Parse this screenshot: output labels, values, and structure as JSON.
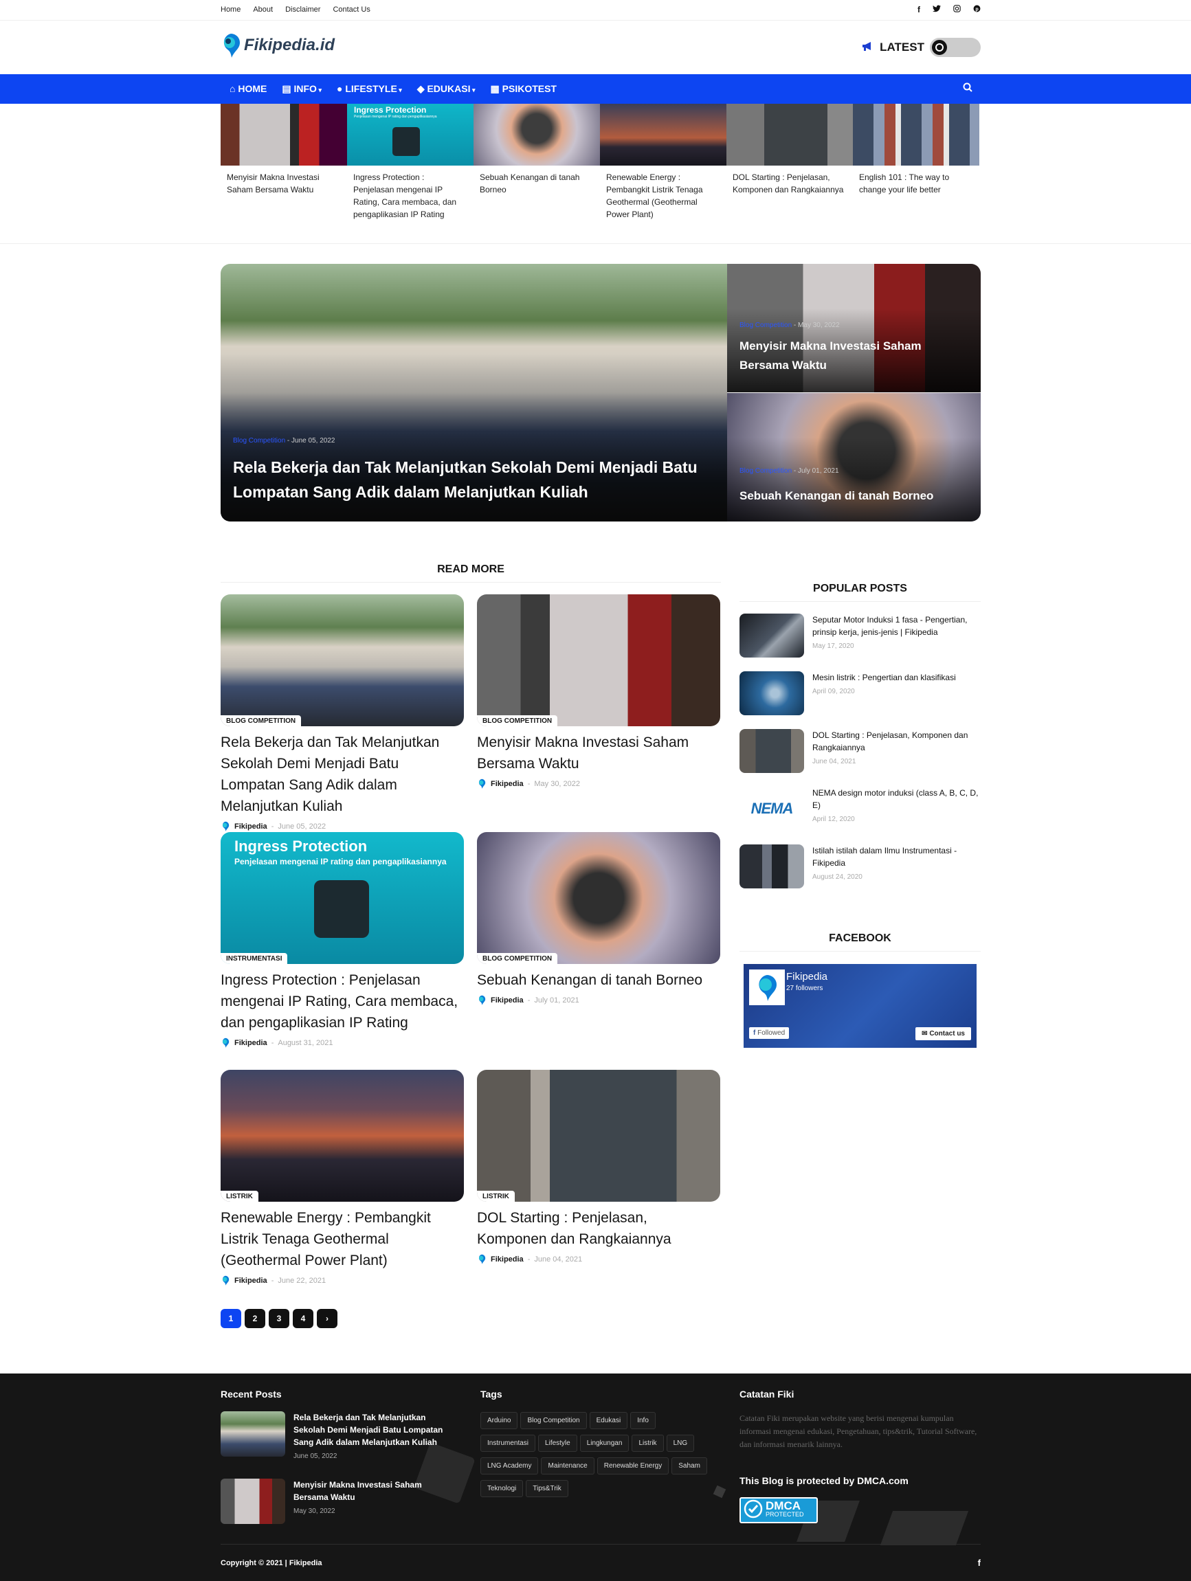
{
  "topbar": {
    "links": [
      "Home",
      "About",
      "Disclaimer",
      "Contact Us"
    ],
    "social_icons": [
      "facebook-icon",
      "twitter-icon",
      "instagram-icon",
      "pinterest-icon"
    ]
  },
  "header": {
    "logo_text": "Fikipedia.id",
    "latest_label": "LATEST"
  },
  "nav": {
    "items": [
      {
        "label": "HOME",
        "icon": "home-icon"
      },
      {
        "label": "INFO",
        "icon": "newspaper-icon"
      },
      {
        "label": "LIFESTYLE",
        "icon": "user-icon"
      },
      {
        "label": "EDUKASI",
        "icon": "graduation-cap-icon"
      },
      {
        "label": "PSIKOTEST",
        "icon": "table-icon"
      }
    ]
  },
  "ticker": [
    {
      "title": "Menyisir Makna Investasi Saham Bersama Waktu"
    },
    {
      "title": "Ingress Protection : Penjelasan mengenai IP Rating, Cara membaca, dan pengaplikasian IP Rating",
      "img_title": "Ingress Protection",
      "img_sub": "Penjelasan mengenai IP rating dan pengaplikasiannya"
    },
    {
      "title": "Sebuah Kenangan di tanah Borneo"
    },
    {
      "title": "Renewable Energy : Pembangkit Listrik Tenaga Geothermal (Geothermal Power Plant)"
    },
    {
      "title": "DOL Starting : Penjelasan, Komponen dan Rangkaiannya"
    },
    {
      "title": "English 101 : The way to change your life better"
    }
  ],
  "hero": {
    "main": {
      "category": "Blog Competition",
      "date": "June 05, 2022",
      "title": "Rela Bekerja dan Tak Melanjutkan Sekolah Demi Menjadi Batu Lompatan Sang Adik dalam Melanjutkan Kuliah"
    },
    "side": [
      {
        "category": "Blog Competition",
        "date": "May 30, 2022",
        "title": "Menyisir Makna Investasi Saham Bersama Waktu"
      },
      {
        "category": "Blog Competition",
        "date": "July 01, 2021",
        "title": "Sebuah Kenangan di tanah Borneo"
      }
    ]
  },
  "read_more": {
    "heading": "READ MORE",
    "posts": [
      {
        "label": "BLOG COMPETITION",
        "title": "Rela Bekerja dan Tak Melanjutkan Sekolah Demi Menjadi Batu Lompatan Sang Adik dalam Melanjutkan Kuliah",
        "author": "Fikipedia",
        "date": "June 05, 2022"
      },
      {
        "label": "BLOG COMPETITION",
        "title": "Menyisir Makna Investasi Saham Bersama Waktu",
        "author": "Fikipedia",
        "date": "May 30, 2022"
      },
      {
        "label": "INSTRUMENTASI",
        "title": "Ingress Protection : Penjelasan mengenai IP Rating, Cara membaca, dan pengaplikasian IP Rating",
        "author": "Fikipedia",
        "date": "August 31, 2021",
        "img_title": "Ingress Protection",
        "img_sub": "Penjelasan mengenai IP rating dan pengaplikasiannya"
      },
      {
        "label": "BLOG COMPETITION",
        "title": "Sebuah Kenangan di tanah Borneo",
        "author": "Fikipedia",
        "date": "July 01, 2021"
      },
      {
        "label": "LISTRIK",
        "title": "Renewable Energy : Pembangkit Listrik Tenaga Geothermal (Geothermal Power Plant)",
        "author": "Fikipedia",
        "date": "June 22, 2021"
      },
      {
        "label": "LISTRIK",
        "title": "DOL Starting : Penjelasan, Komponen dan Rangkaiannya",
        "author": "Fikipedia",
        "date": "June 04, 2021"
      }
    ]
  },
  "pagination": {
    "pages": [
      "1",
      "2",
      "3",
      "4"
    ],
    "next_icon": "chevron-right-icon"
  },
  "popular": {
    "heading": "POPULAR POSTS",
    "posts": [
      {
        "title": "Seputar Motor Induksi 1 fasa - Pengertian, prinsip kerja, jenis-jenis | Fikipedia",
        "date": "May 17, 2020"
      },
      {
        "title": "Mesin listrik : Pengertian dan klasifikasi",
        "date": "April 09, 2020"
      },
      {
        "title": "DOL Starting : Penjelasan, Komponen dan Rangkaiannya",
        "date": "June 04, 2021"
      },
      {
        "title": "NEMA design motor induksi (class A, B, C, D, E)",
        "date": "April 12, 2020",
        "img_text": "NEMA"
      },
      {
        "title": "Istilah istilah dalam Ilmu Instrumentasi - Fikipedia",
        "date": "August 24, 2020"
      }
    ]
  },
  "facebook": {
    "heading": "FACEBOOK",
    "page_name": "Fikipedia",
    "followers": "27 followers",
    "followed_label": "Followed",
    "contact_label": "Contact us"
  },
  "footer": {
    "recent_heading": "Recent Posts",
    "recent": [
      {
        "title": "Rela Bekerja dan Tak Melanjutkan Sekolah Demi Menjadi Batu Lompatan Sang Adik dalam Melanjutkan Kuliah",
        "date": "June 05, 2022"
      },
      {
        "title": "Menyisir Makna Investasi Saham Bersama Waktu",
        "date": "May 30, 2022"
      }
    ],
    "tags_heading": "Tags",
    "tags": [
      "Arduino",
      "Blog Competition",
      "Edukasi",
      "Info",
      "Instrumentasi",
      "Lifestyle",
      "Lingkungan",
      "Listrik",
      "LNG",
      "LNG Academy",
      "Maintenance",
      "Renewable Energy",
      "Saham",
      "Teknologi",
      "Tips&Trik"
    ],
    "about_heading": "Catatan Fiki",
    "about_text": "Catatan Fiki merupakan website yang berisi mengenai kumpulan informasi mengenai edukasi, Pengetahuan, tips&trik, Tutorial Software, dan informasi menarik lainnya.",
    "dmca_heading": "This Blog is protected by DMCA.com",
    "dmca_badge": "DMCA",
    "dmca_badge_sub": "PROTECTED",
    "copyright": "Copyright © 2021 | Fikipedia"
  },
  "colors": {
    "accent": "#0d45f2",
    "footer_bg": "#161616"
  }
}
